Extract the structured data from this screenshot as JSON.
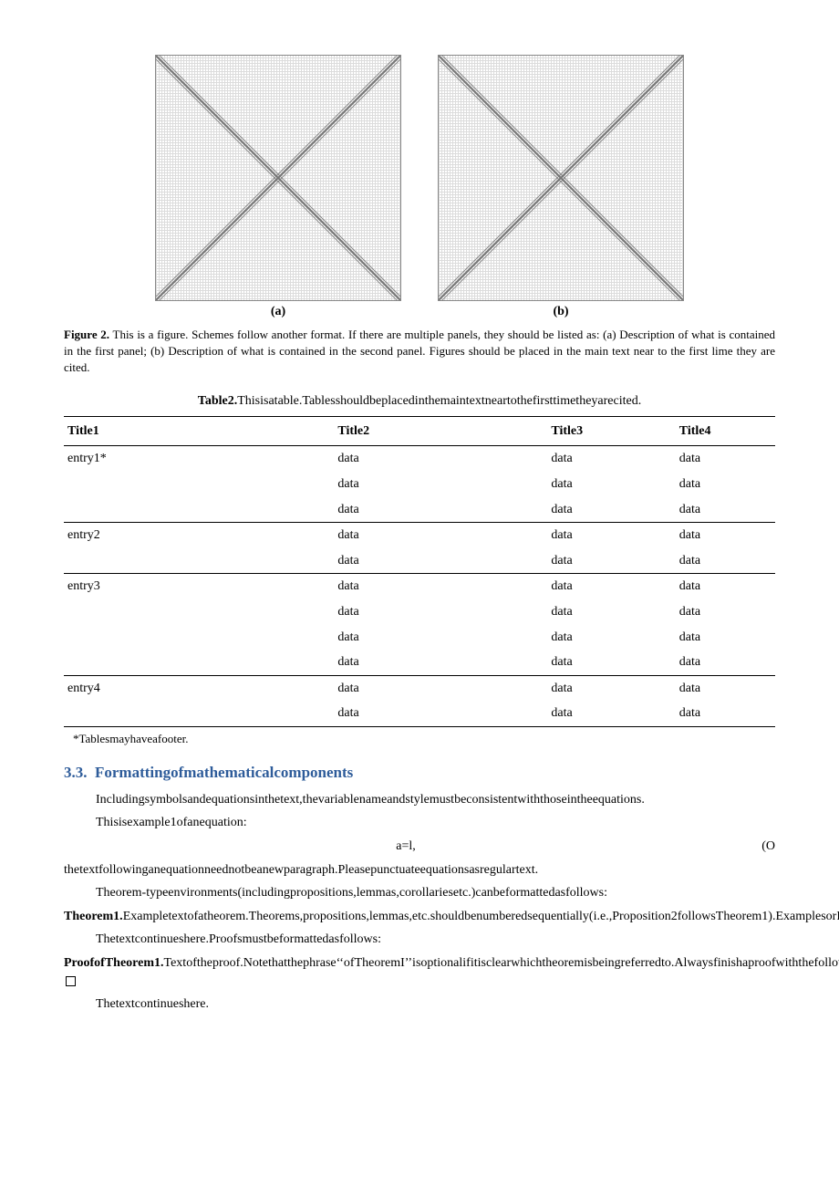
{
  "figure": {
    "panel_a_label": "(a)",
    "panel_b_label": "(b)",
    "caption_lead": "Figure 2.",
    "caption_text": " This is a figure. Schemes follow another format. If there are multiple panels, they should be listed as: (a) Description of what is contained in the first panel; (b) Description of what is contained in the second panel. Figures should be placed in the main text near to the first lime they are cited."
  },
  "table": {
    "caption_lead": "Table2.",
    "caption_text": "Thisisatable.Tablesshouldbeplacedinthemaintextneartothefirsttimetheyarecited.",
    "headers": [
      "Title1",
      "Title2",
      "Title3",
      "Title4"
    ],
    "groups": [
      {
        "entry": "entry1*",
        "rows": [
          [
            "data",
            "data",
            "data"
          ],
          [
            "data",
            "data",
            "data"
          ],
          [
            "data",
            "data",
            "data"
          ]
        ]
      },
      {
        "entry": "entry2",
        "rows": [
          [
            "data",
            "data",
            "data"
          ],
          [
            "data",
            "data",
            "data"
          ]
        ]
      },
      {
        "entry": "entry3",
        "rows": [
          [
            "data",
            "data",
            "data"
          ],
          [
            "data",
            "data",
            "data"
          ],
          [
            "data",
            "data",
            "data"
          ],
          [
            "data",
            "data",
            "data"
          ]
        ]
      },
      {
        "entry": "entry4",
        "rows": [
          [
            "data",
            "data",
            "data"
          ],
          [
            "data",
            "data",
            "data"
          ]
        ]
      }
    ],
    "footer": "*Tablesmayhaveafooter."
  },
  "section": {
    "number": "3.3.",
    "title": "Formattingofmathematicalcomponents"
  },
  "body": {
    "p1": "Includingsymbolsandequationsinthetext,thevariablenameandstylemustbeconsistentwiththoseintheequations.",
    "p2": "Thisisexample1ofanequation:",
    "eq_text": "a=l,",
    "eq_num": "(O",
    "p3": "thetextfollowinganequationneednotbeanewparagraph.Pleasepunctuateequationsasregulartext.",
    "p4": "Theorem-typeenvironments(includingpropositions,lemmas,corollariesetc.)canbeformattedasfollows:",
    "theorem_lead": "Theorem1.",
    "theorem_body": "Exampletextofatheorem.Theorems,propositions,lemmas,etc.shouldbenumberedsequentially(i.e.,Proposition2followsTheorem1).ExamplesorRemarksusethesameformatting,butshouldbenumberedseparately,soadocumentmaycontainTheorem1,Remark1andExampleI.",
    "p5": "Thetextcontinueshere.Proofsmustbeformattedasfollows:",
    "proof_lead": "ProofofTheorem1.",
    "proof_body": "Textoftheproof.Notethatthephrase‘‘ofTheoremI’’isoptionalifitisclearwhichtheoremisbeingreferredto.Alwaysfinishaproofwiththefollowingsymbol.",
    "p6": "Thetextcontinueshere."
  }
}
